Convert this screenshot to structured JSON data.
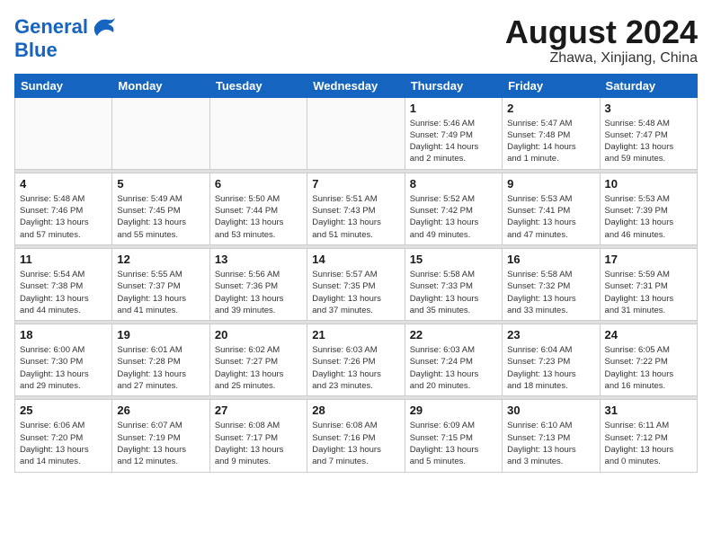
{
  "header": {
    "logo_line1": "General",
    "logo_line2": "Blue",
    "month": "August 2024",
    "location": "Zhawa, Xinjiang, China"
  },
  "weekdays": [
    "Sunday",
    "Monday",
    "Tuesday",
    "Wednesday",
    "Thursday",
    "Friday",
    "Saturday"
  ],
  "weeks": [
    [
      {
        "day": "",
        "info": ""
      },
      {
        "day": "",
        "info": ""
      },
      {
        "day": "",
        "info": ""
      },
      {
        "day": "",
        "info": ""
      },
      {
        "day": "1",
        "info": "Sunrise: 5:46 AM\nSunset: 7:49 PM\nDaylight: 14 hours\nand 2 minutes."
      },
      {
        "day": "2",
        "info": "Sunrise: 5:47 AM\nSunset: 7:48 PM\nDaylight: 14 hours\nand 1 minute."
      },
      {
        "day": "3",
        "info": "Sunrise: 5:48 AM\nSunset: 7:47 PM\nDaylight: 13 hours\nand 59 minutes."
      }
    ],
    [
      {
        "day": "4",
        "info": "Sunrise: 5:48 AM\nSunset: 7:46 PM\nDaylight: 13 hours\nand 57 minutes."
      },
      {
        "day": "5",
        "info": "Sunrise: 5:49 AM\nSunset: 7:45 PM\nDaylight: 13 hours\nand 55 minutes."
      },
      {
        "day": "6",
        "info": "Sunrise: 5:50 AM\nSunset: 7:44 PM\nDaylight: 13 hours\nand 53 minutes."
      },
      {
        "day": "7",
        "info": "Sunrise: 5:51 AM\nSunset: 7:43 PM\nDaylight: 13 hours\nand 51 minutes."
      },
      {
        "day": "8",
        "info": "Sunrise: 5:52 AM\nSunset: 7:42 PM\nDaylight: 13 hours\nand 49 minutes."
      },
      {
        "day": "9",
        "info": "Sunrise: 5:53 AM\nSunset: 7:41 PM\nDaylight: 13 hours\nand 47 minutes."
      },
      {
        "day": "10",
        "info": "Sunrise: 5:53 AM\nSunset: 7:39 PM\nDaylight: 13 hours\nand 46 minutes."
      }
    ],
    [
      {
        "day": "11",
        "info": "Sunrise: 5:54 AM\nSunset: 7:38 PM\nDaylight: 13 hours\nand 44 minutes."
      },
      {
        "day": "12",
        "info": "Sunrise: 5:55 AM\nSunset: 7:37 PM\nDaylight: 13 hours\nand 41 minutes."
      },
      {
        "day": "13",
        "info": "Sunrise: 5:56 AM\nSunset: 7:36 PM\nDaylight: 13 hours\nand 39 minutes."
      },
      {
        "day": "14",
        "info": "Sunrise: 5:57 AM\nSunset: 7:35 PM\nDaylight: 13 hours\nand 37 minutes."
      },
      {
        "day": "15",
        "info": "Sunrise: 5:58 AM\nSunset: 7:33 PM\nDaylight: 13 hours\nand 35 minutes."
      },
      {
        "day": "16",
        "info": "Sunrise: 5:58 AM\nSunset: 7:32 PM\nDaylight: 13 hours\nand 33 minutes."
      },
      {
        "day": "17",
        "info": "Sunrise: 5:59 AM\nSunset: 7:31 PM\nDaylight: 13 hours\nand 31 minutes."
      }
    ],
    [
      {
        "day": "18",
        "info": "Sunrise: 6:00 AM\nSunset: 7:30 PM\nDaylight: 13 hours\nand 29 minutes."
      },
      {
        "day": "19",
        "info": "Sunrise: 6:01 AM\nSunset: 7:28 PM\nDaylight: 13 hours\nand 27 minutes."
      },
      {
        "day": "20",
        "info": "Sunrise: 6:02 AM\nSunset: 7:27 PM\nDaylight: 13 hours\nand 25 minutes."
      },
      {
        "day": "21",
        "info": "Sunrise: 6:03 AM\nSunset: 7:26 PM\nDaylight: 13 hours\nand 23 minutes."
      },
      {
        "day": "22",
        "info": "Sunrise: 6:03 AM\nSunset: 7:24 PM\nDaylight: 13 hours\nand 20 minutes."
      },
      {
        "day": "23",
        "info": "Sunrise: 6:04 AM\nSunset: 7:23 PM\nDaylight: 13 hours\nand 18 minutes."
      },
      {
        "day": "24",
        "info": "Sunrise: 6:05 AM\nSunset: 7:22 PM\nDaylight: 13 hours\nand 16 minutes."
      }
    ],
    [
      {
        "day": "25",
        "info": "Sunrise: 6:06 AM\nSunset: 7:20 PM\nDaylight: 13 hours\nand 14 minutes."
      },
      {
        "day": "26",
        "info": "Sunrise: 6:07 AM\nSunset: 7:19 PM\nDaylight: 13 hours\nand 12 minutes."
      },
      {
        "day": "27",
        "info": "Sunrise: 6:08 AM\nSunset: 7:17 PM\nDaylight: 13 hours\nand 9 minutes."
      },
      {
        "day": "28",
        "info": "Sunrise: 6:08 AM\nSunset: 7:16 PM\nDaylight: 13 hours\nand 7 minutes."
      },
      {
        "day": "29",
        "info": "Sunrise: 6:09 AM\nSunset: 7:15 PM\nDaylight: 13 hours\nand 5 minutes."
      },
      {
        "day": "30",
        "info": "Sunrise: 6:10 AM\nSunset: 7:13 PM\nDaylight: 13 hours\nand 3 minutes."
      },
      {
        "day": "31",
        "info": "Sunrise: 6:11 AM\nSunset: 7:12 PM\nDaylight: 13 hours\nand 0 minutes."
      }
    ]
  ]
}
